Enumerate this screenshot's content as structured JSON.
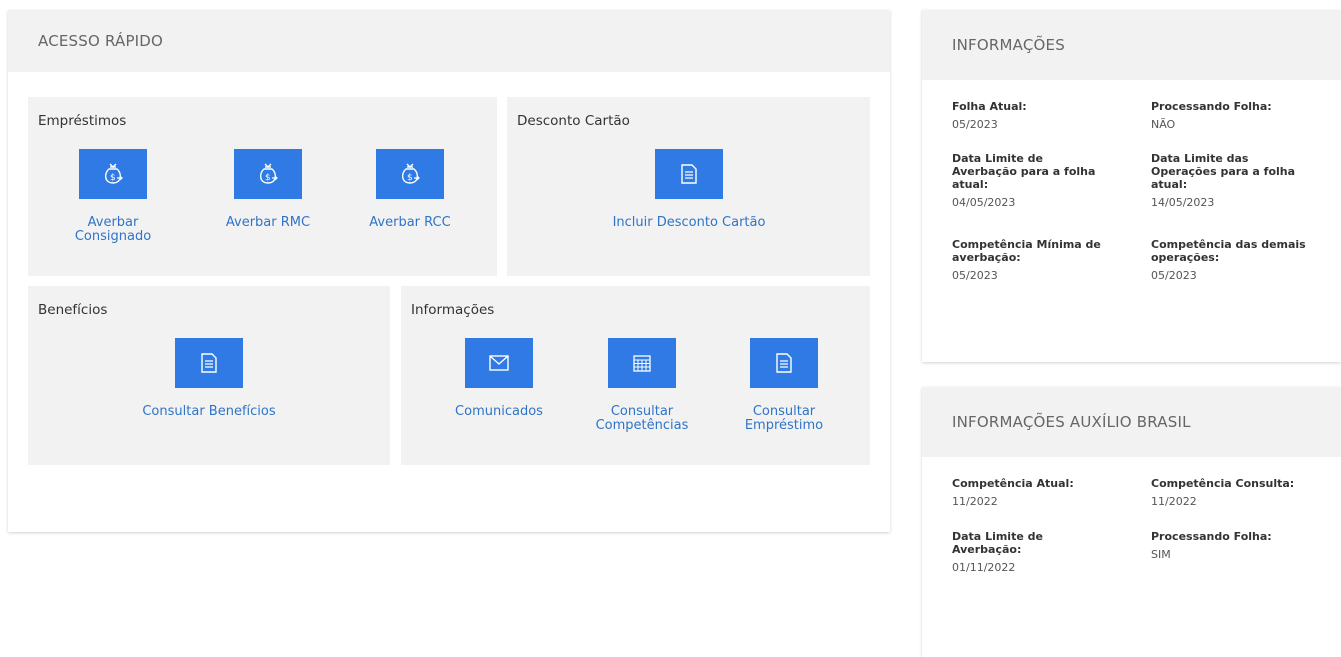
{
  "quick_access": {
    "title": "ACESSO RÁPIDO",
    "emprestimos": {
      "title": "Empréstimos",
      "items": [
        {
          "label": "Averbar Consignado",
          "icon": "money-bag-icon"
        },
        {
          "label": "Averbar RMC",
          "icon": "money-bag-icon"
        },
        {
          "label": "Averbar RCC",
          "icon": "money-bag-icon"
        }
      ]
    },
    "desconto_cartao": {
      "title": "Desconto Cartão",
      "items": [
        {
          "label": "Incluir Desconto Cartão",
          "icon": "document-icon"
        }
      ]
    },
    "beneficios": {
      "title": "Benefícios",
      "items": [
        {
          "label": "Consultar Benefícios",
          "icon": "document-icon"
        }
      ]
    },
    "informacoes": {
      "title": "Informações",
      "items": [
        {
          "label": "Comunicados",
          "icon": "envelope-icon"
        },
        {
          "label": "Consultar\nCompetências",
          "icon": "calendar-icon"
        },
        {
          "label": "Consultar\nEmpréstimo",
          "icon": "document-icon"
        }
      ]
    }
  },
  "informacoes": {
    "title": "INFORMAÇÕES",
    "items": [
      {
        "label": "Folha Atual:",
        "value": "05/2023"
      },
      {
        "label": "Processando Folha:",
        "value": "NÃO"
      },
      {
        "label": "Data Limite de\nAverbação para a folha\natual:",
        "value": "04/05/2023"
      },
      {
        "label": "Data Limite das\nOperações para a folha\natual:",
        "value": "14/05/2023"
      },
      {
        "label": "Competência Mínima de\naverbação:",
        "value": "05/2023"
      },
      {
        "label": "Competência das demais\noperações:",
        "value": "05/2023"
      }
    ]
  },
  "auxilio_brasil": {
    "title": "INFORMAÇÕES AUXÍLIO BRASIL",
    "items": [
      {
        "label": "Competência Atual:",
        "value": "11/2022"
      },
      {
        "label": "Competência Consulta:",
        "value": "11/2022"
      },
      {
        "label": "Data Limite de\nAverbação:",
        "value": "01/11/2022"
      },
      {
        "label": "Processando Folha:",
        "value": "SIM"
      }
    ]
  },
  "colors": {
    "accent": "#2f7ae5",
    "link": "#2f74c8",
    "panel": "#f2f2f2"
  }
}
